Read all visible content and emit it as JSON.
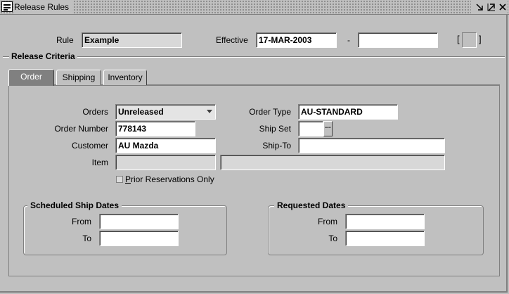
{
  "window": {
    "title": "Release Rules"
  },
  "header": {
    "rule_label": "Rule",
    "rule_value": "Example",
    "effective_label": "Effective",
    "effective_from": "17-MAR-2003",
    "effective_separator": "-",
    "effective_to": "",
    "bracket_open": "[",
    "bracket_close": "]"
  },
  "section": {
    "title": "Release Criteria"
  },
  "tabs": [
    {
      "label": "Order",
      "active": true
    },
    {
      "label": "Shipping",
      "active": false
    },
    {
      "label": "Inventory",
      "active": false
    }
  ],
  "order_tab": {
    "orders_label": "Orders",
    "orders_value": "Unreleased",
    "order_type_label": "Order Type",
    "order_type_value": "AU-STANDARD",
    "order_number_label": "Order Number",
    "order_number_value": "778143",
    "ship_set_label": "Ship Set",
    "ship_set_value": "",
    "ship_set_lov": "...",
    "customer_label": "Customer",
    "customer_value": "AU Mazda",
    "ship_to_label": "Ship-To",
    "ship_to_value": "",
    "item_label": "Item",
    "item_value": "",
    "item_desc_value": "",
    "prior_res_label_first": "P",
    "prior_res_label_rest": "rior Reservations Only",
    "prior_res_checked": false
  },
  "scheduled_ship_dates": {
    "title": "Scheduled Ship Dates",
    "from_label": "From",
    "from_value": "",
    "to_label": "To",
    "to_value": ""
  },
  "requested_dates": {
    "title": "Requested Dates",
    "from_label": "From",
    "from_value": "",
    "to_label": "To",
    "to_value": ""
  },
  "colors": {
    "background": "#c0c0c0",
    "field_background": "#ffffff",
    "readonly_field": "#d8d8d8",
    "active_tab": "#808080"
  }
}
